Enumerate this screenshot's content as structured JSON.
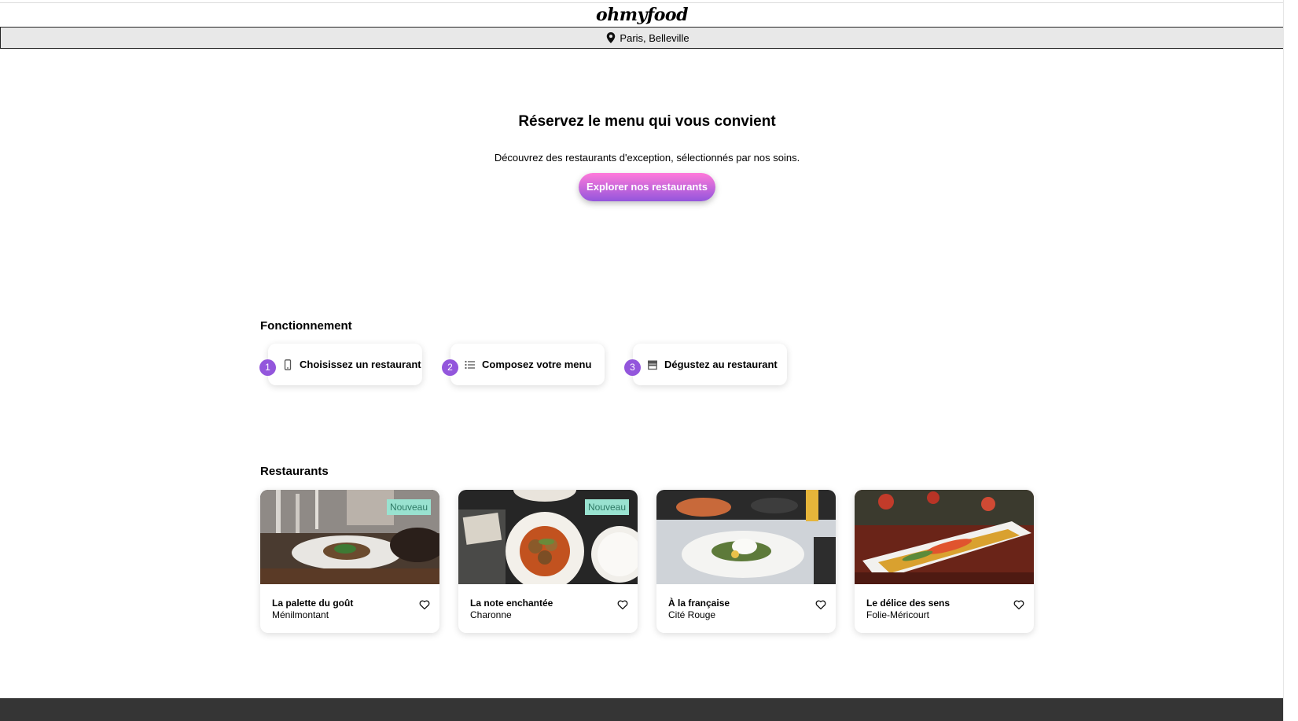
{
  "brand": {
    "logo_text": "ohmyfood"
  },
  "location": {
    "text": "Paris, Belleville"
  },
  "hero": {
    "title": "Réservez le menu qui vous convient",
    "subtitle": "Découvrez des restaurants d'exception, sélectionnés par nos soins.",
    "cta_label": "Explorer nos restaurants"
  },
  "how_it_works": {
    "title": "Fonctionnement",
    "steps": [
      {
        "number": "1",
        "label": "Choisissez un restaurant",
        "icon": "mobile-phone-icon"
      },
      {
        "number": "2",
        "label": "Composez votre menu",
        "icon": "list-icon"
      },
      {
        "number": "3",
        "label": "Dégustez au restaurant",
        "icon": "store-icon"
      }
    ]
  },
  "restaurants": {
    "title": "Restaurants",
    "items": [
      {
        "name": "La palette du goût",
        "area": "Ménilmontant",
        "badge": "Nouveau",
        "icon": "heart-outline-icon"
      },
      {
        "name": "La note enchantée",
        "area": "Charonne",
        "badge": "Nouveau",
        "icon": "heart-outline-icon"
      },
      {
        "name": "À la française",
        "area": "Cité Rouge",
        "badge": "",
        "icon": "heart-outline-icon"
      },
      {
        "name": "Le délice des sens",
        "area": "Folie-Méricourt",
        "badge": "",
        "icon": "heart-outline-icon"
      }
    ]
  },
  "colors": {
    "accent_purple": "#9356dc",
    "accent_pink": "#ff79da",
    "badge_bg": "#99e2d0",
    "footer_bg": "#353535"
  }
}
